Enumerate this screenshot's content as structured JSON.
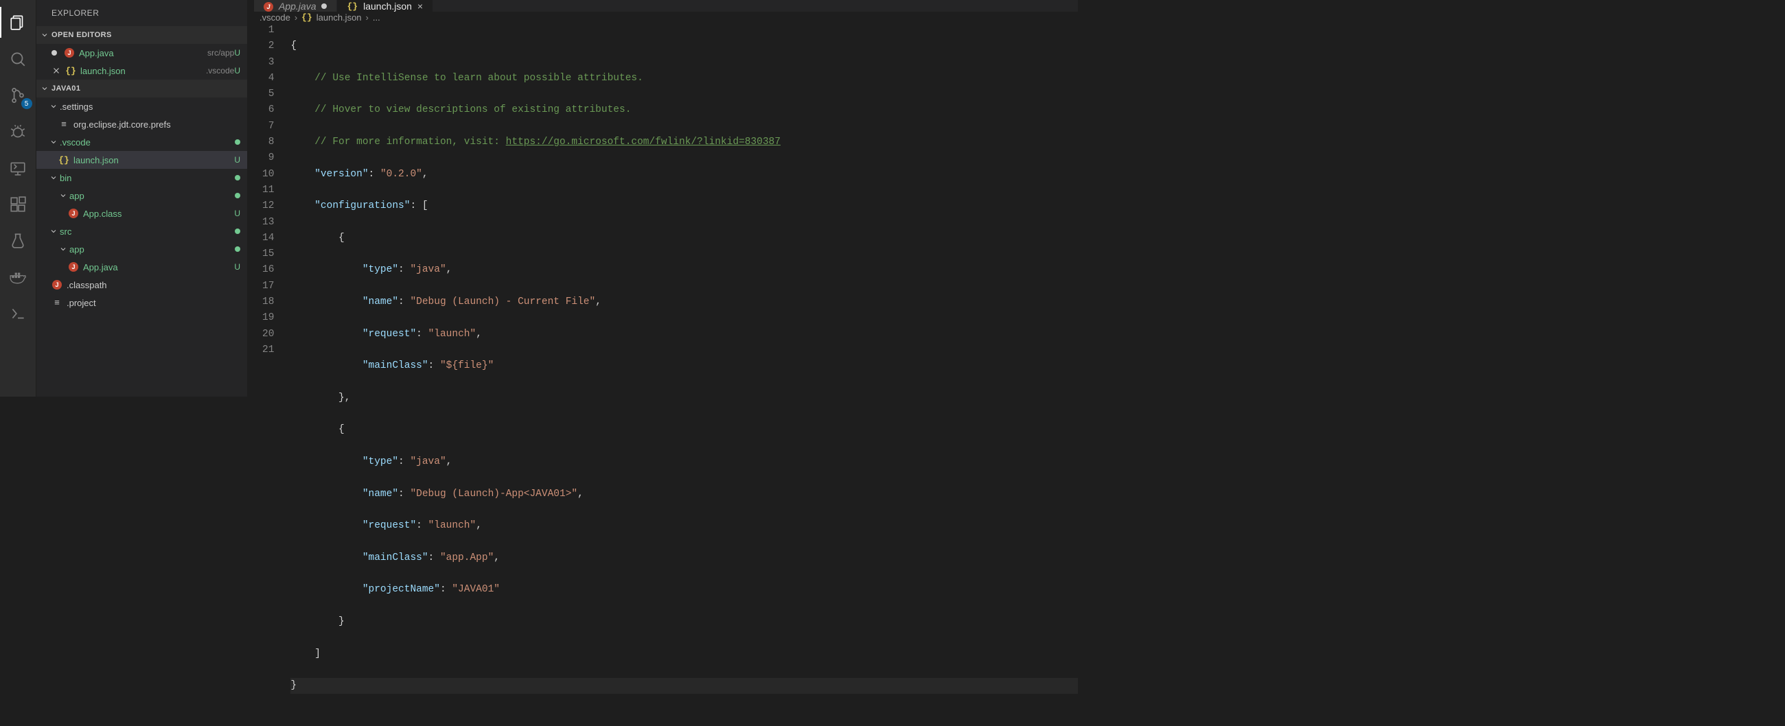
{
  "explorer_title": "EXPLORER",
  "sections": {
    "open_editors": "OPEN EDITORS",
    "project": "JAVA01"
  },
  "open_editors": [
    {
      "name": "App.java",
      "hint": "src/app",
      "status": "U",
      "modified": true,
      "icon": "java"
    },
    {
      "name": "launch.json",
      "hint": ".vscode",
      "status": "U",
      "modified": false,
      "icon": "json",
      "closeable": true
    }
  ],
  "tree": {
    "settings_folder": ".settings",
    "prefs_file": "org.eclipse.jdt.core.prefs",
    "vscode_folder": ".vscode",
    "launch_file": "launch.json",
    "bin_folder": "bin",
    "bin_app_folder": "app",
    "app_class": "App.class",
    "src_folder": "src",
    "src_app_folder": "app",
    "app_java": "App.java",
    "classpath": ".classpath",
    "project": ".project"
  },
  "status": {
    "U": "U"
  },
  "source_control_badge": "5",
  "tabs": [
    {
      "label": "App.java",
      "active": false,
      "icon": "java",
      "modified": true,
      "italic": true
    },
    {
      "label": "launch.json",
      "active": true,
      "icon": "json",
      "modified": false
    }
  ],
  "breadcrumbs": {
    "a": ".vscode",
    "b": "launch.json",
    "c": "..."
  },
  "editor": {
    "comment1": "// Use IntelliSense to learn about possible attributes.",
    "comment2": "// Hover to view descriptions of existing attributes.",
    "comment3_pre": "// For more information, visit: ",
    "comment3_link": "https://go.microsoft.com/fwlink/?linkid=830387",
    "keys": {
      "version": "\"version\"",
      "configurations": "\"configurations\"",
      "type": "\"type\"",
      "name": "\"name\"",
      "request": "\"request\"",
      "mainClass": "\"mainClass\"",
      "projectName": "\"projectName\""
    },
    "vals": {
      "version": "\"0.2.0\"",
      "java": "\"java\"",
      "name1": "\"Debug (Launch) - Current File\"",
      "launch": "\"launch\"",
      "file": "\"${file}\"",
      "name2": "\"Debug (Launch)-App<JAVA01>\"",
      "appApp": "\"app.App\"",
      "proj": "\"JAVA01\""
    }
  }
}
